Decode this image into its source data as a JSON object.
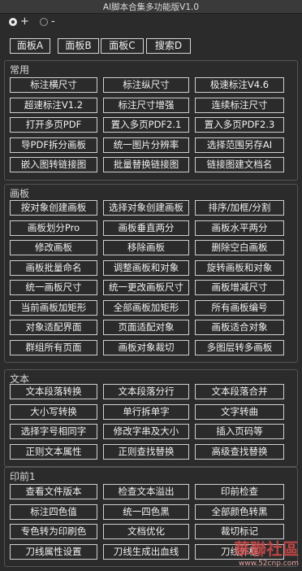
{
  "window": {
    "title": "AI脚本合集多功能版V1.0"
  },
  "mode": {
    "plus_label": "+",
    "minus_label": "-"
  },
  "panels": [
    "面板A",
    "面板B",
    "面板C",
    "搜索D"
  ],
  "sections": [
    {
      "title": "常用",
      "rows": [
        [
          "标注横尺寸",
          "标注纵尺寸",
          "极速标注V4.6"
        ],
        [
          "超速标注V1.2",
          "标注尺寸增强",
          "连续标注尺寸"
        ],
        [
          "打开多页PDF",
          "置入多页PDF2.1",
          "置入多页PDF2.3"
        ],
        [
          "导PDF拆分画板",
          "统一图片分辨率",
          "选择范围另存AI"
        ],
        [
          "嵌入图转链接图",
          "批量替换链接图",
          "链接图建文档名"
        ]
      ]
    },
    {
      "title": "画板",
      "rows": [
        [
          "按对象创建画板",
          "选择对象创建画板",
          "排序/加框/分割"
        ],
        [
          "画板划分Pro",
          "画板垂直两分",
          "画板水平两分"
        ],
        [
          "修改画板",
          "移除画板",
          "删除空白画板"
        ],
        [
          "画板批量命名",
          "调整画板和对象",
          "旋转画板和对象"
        ],
        [
          "统一画板尺寸",
          "统一更改画板尺寸",
          "画板增减尺寸"
        ],
        [
          "当前画板加矩形",
          "全部画板加矩形",
          "所有画板编号"
        ],
        [
          "对象适配界面",
          "页面适配对象",
          "画板适合对象"
        ],
        [
          "群组所有页面",
          "画板对象裁切",
          "多图层转多画板"
        ]
      ]
    },
    {
      "title": "文本",
      "rows": [
        [
          "文本段落转换",
          "文本段落分行",
          "文本段落合并"
        ],
        [
          "大小写转换",
          "单行拆单字",
          "文字转曲"
        ],
        [
          "选择字号相同字",
          "修改字串及大小",
          "插入页码等"
        ],
        [
          "正则文本属性",
          "正则查找替换",
          "高级查找替换"
        ]
      ]
    },
    {
      "title": "印前1",
      "rows": [
        [
          "查看文件版本",
          "检查文本溢出",
          "印前检查"
        ],
        [
          "标注四色值",
          "统一四色黑",
          "全部颜色转黑"
        ],
        [
          "专色转为印刷色",
          "文档优化",
          "裁切标记"
        ],
        [
          "刀线属性设置",
          "刀线生成出血线",
          "刀线外框"
        ]
      ]
    }
  ],
  "watermark": {
    "text": "華聯社區",
    "url": "www.52cnp.com"
  }
}
